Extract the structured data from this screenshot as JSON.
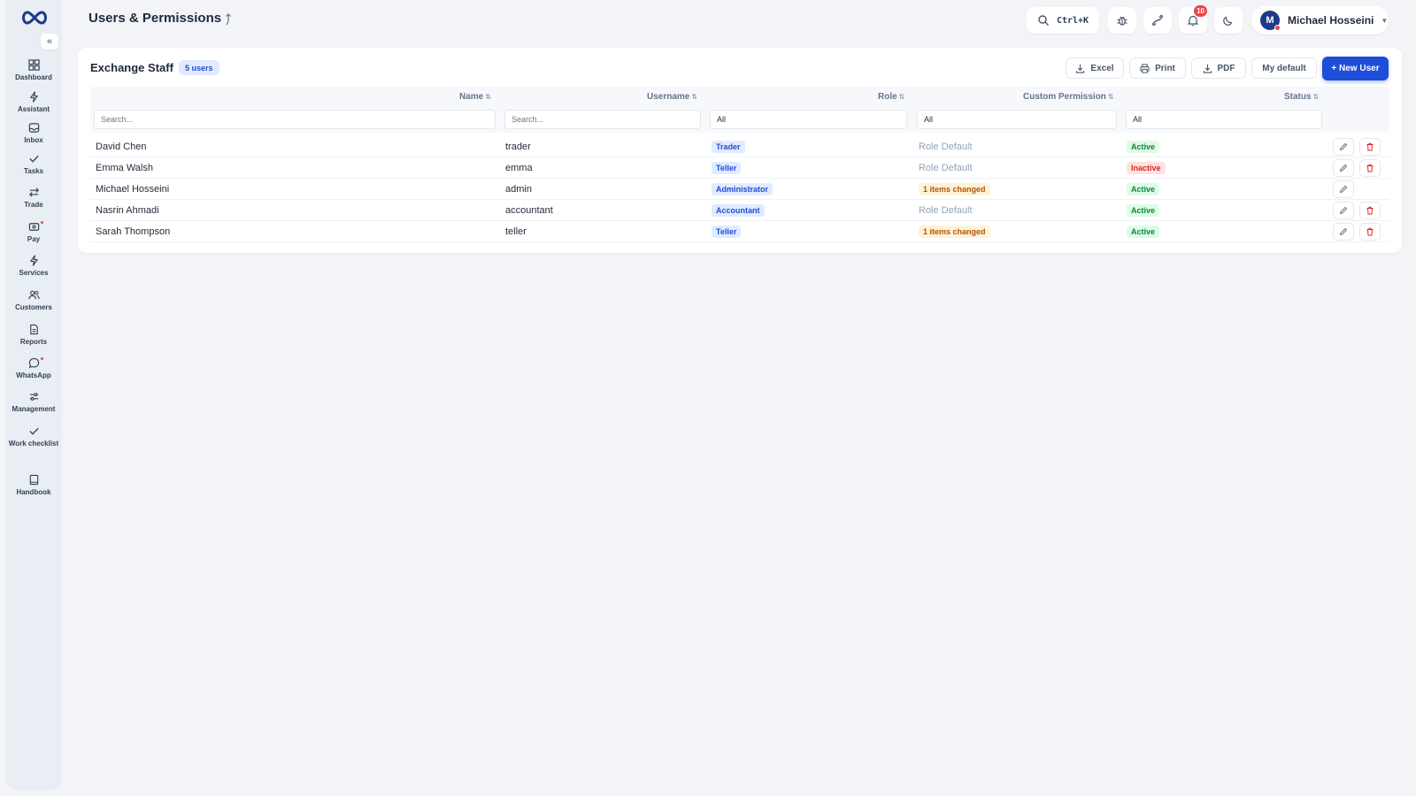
{
  "header": {
    "title": "Users & Permissions",
    "search_shortcut": "Ctrl+K",
    "notification_count": "10",
    "user_initial": "M",
    "user_name": "Michael Hosseini"
  },
  "sidebar": {
    "collapse_label": "«",
    "items": [
      {
        "label": "Dashboard",
        "icon": "dashboard-icon"
      },
      {
        "label": "Assistant",
        "icon": "bolt-icon"
      },
      {
        "label": "Inbox",
        "icon": "inbox-icon"
      },
      {
        "label": "Tasks",
        "icon": "check-icon"
      },
      {
        "label": "Trade",
        "icon": "swap-icon"
      },
      {
        "label": "Pay",
        "icon": "wallet-icon"
      },
      {
        "label": "Services",
        "icon": "bolt-icon"
      },
      {
        "label": "Customers",
        "icon": "users-icon"
      },
      {
        "label": "Reports",
        "icon": "document-icon"
      },
      {
        "label": "WhatsApp",
        "icon": "chat-icon"
      },
      {
        "label": "Management",
        "icon": "sliders-icon"
      },
      {
        "label": "Work checklist",
        "icon": "check-icon"
      },
      {
        "label": "Handbook",
        "icon": "book-icon"
      }
    ]
  },
  "card": {
    "title": "Exchange Staff",
    "count_badge": "5 users",
    "buttons": {
      "excel": "Excel",
      "print": "Print",
      "pdf": "PDF",
      "my_default": "My default",
      "new_user": "+ New User"
    }
  },
  "table": {
    "columns": [
      "Name",
      "Username",
      "Role",
      "Custom Permission",
      "Status"
    ],
    "sort_glyph": "⇅",
    "filters": {
      "name_placeholder": "Search...",
      "username_placeholder": "Search...",
      "role_value": "All",
      "custom_permission_value": "All",
      "status_value": "All"
    },
    "rows": [
      {
        "name": "David Chen",
        "username": "trader",
        "role": "Trader",
        "custom_permission": "Role Default",
        "status": "Active"
      },
      {
        "name": "Emma Walsh",
        "username": "emma",
        "role": "Teller",
        "custom_permission": "Role Default",
        "status": "Inactive"
      },
      {
        "name": "Michael Hosseini",
        "username": "admin",
        "role": "Administrator",
        "custom_permission": "1 items changed",
        "status": "Active"
      },
      {
        "name": "Nasrin Ahmadi",
        "username": "accountant",
        "role": "Accountant",
        "custom_permission": "Role Default",
        "status": "Active"
      },
      {
        "name": "Sarah Thompson",
        "username": "teller",
        "role": "Teller",
        "custom_permission": "1 items changed",
        "status": "Active"
      }
    ]
  },
  "colors": {
    "accent": "#1d4ed8",
    "active": "#15803d",
    "inactive": "#dc2626",
    "changed": "#b45309"
  }
}
